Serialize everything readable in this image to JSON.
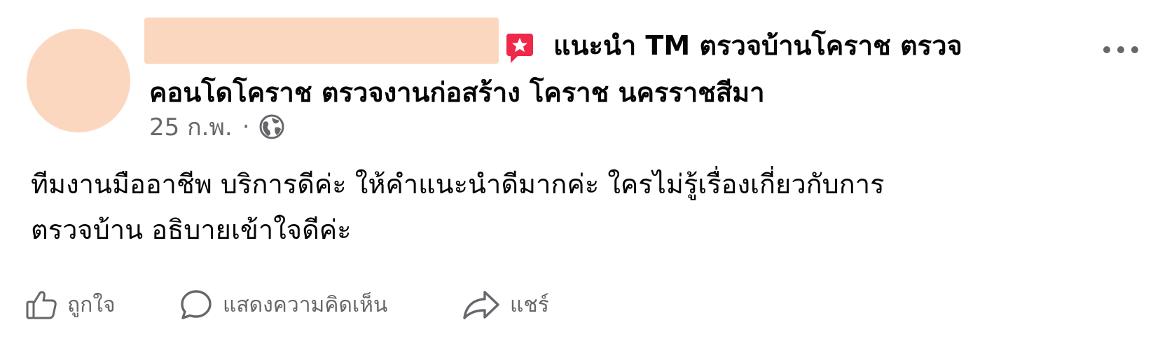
{
  "post": {
    "author_name": "",
    "header_line_1": "แนะนำ TM ตรวจบ้านโคราช ตรวจ",
    "header_line_2": "คอนโดโคราช ตรวจงานก่อสร้าง โคราช นครราชสีมา",
    "date": "25 ก.พ.",
    "separator": "·",
    "audience_icon": "globe-icon",
    "body_line_1": "ทีมงานมืออาชีพ บริการดีค่ะ ให้คำแนะนำดีมากค่ะ ใครไม่รู้เรื่องเกี่ยวกับการ",
    "body_line_2": "ตรวจบ้าน อธิบายเข้าใจดีค่ะ",
    "recommend_icon": "recommend-flag-icon",
    "more_icon": "more-options-icon"
  },
  "actions": {
    "like_label": "ถูกใจ",
    "comment_label": "แสดงความคิดเห็น",
    "share_label": "แชร์"
  },
  "colors": {
    "redaction": "#fcd7c0",
    "recommend": "#f02849",
    "secondary_text": "#65676b",
    "primary_text": "#050505"
  }
}
